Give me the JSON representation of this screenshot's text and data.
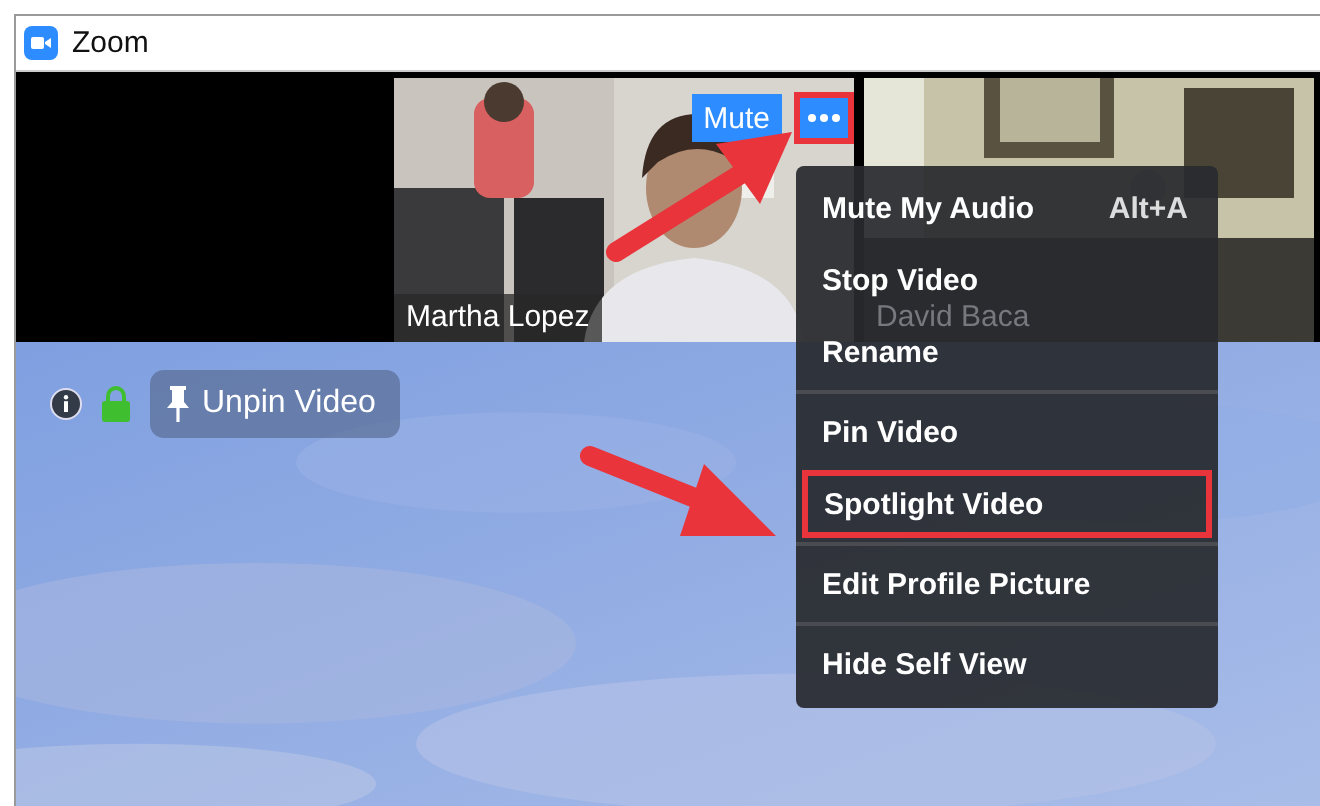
{
  "window": {
    "title": "Zoom"
  },
  "videos": [
    {
      "name": "Martha Lopez",
      "kind": "self"
    },
    {
      "name": "David Baca",
      "kind": "other"
    }
  ],
  "tile_controls": {
    "mute": "Mute",
    "more_highlighted": true
  },
  "toolbar": {
    "unpin": "Unpin Video"
  },
  "menu": [
    {
      "label": "Mute My Audio",
      "shortcut": "Alt+A",
      "divider_before": false,
      "highlighted": false
    },
    {
      "label": "Stop Video",
      "divider_before": false,
      "highlighted": false
    },
    {
      "label": "Rename",
      "divider_before": false,
      "highlighted": false
    },
    {
      "label": "Pin Video",
      "divider_before": true,
      "highlighted": false
    },
    {
      "label": "Spotlight Video",
      "divider_before": false,
      "highlighted": true
    },
    {
      "label": "Edit Profile Picture",
      "divider_before": true,
      "highlighted": false
    },
    {
      "label": "Hide Self View",
      "divider_before": true,
      "highlighted": false
    }
  ]
}
